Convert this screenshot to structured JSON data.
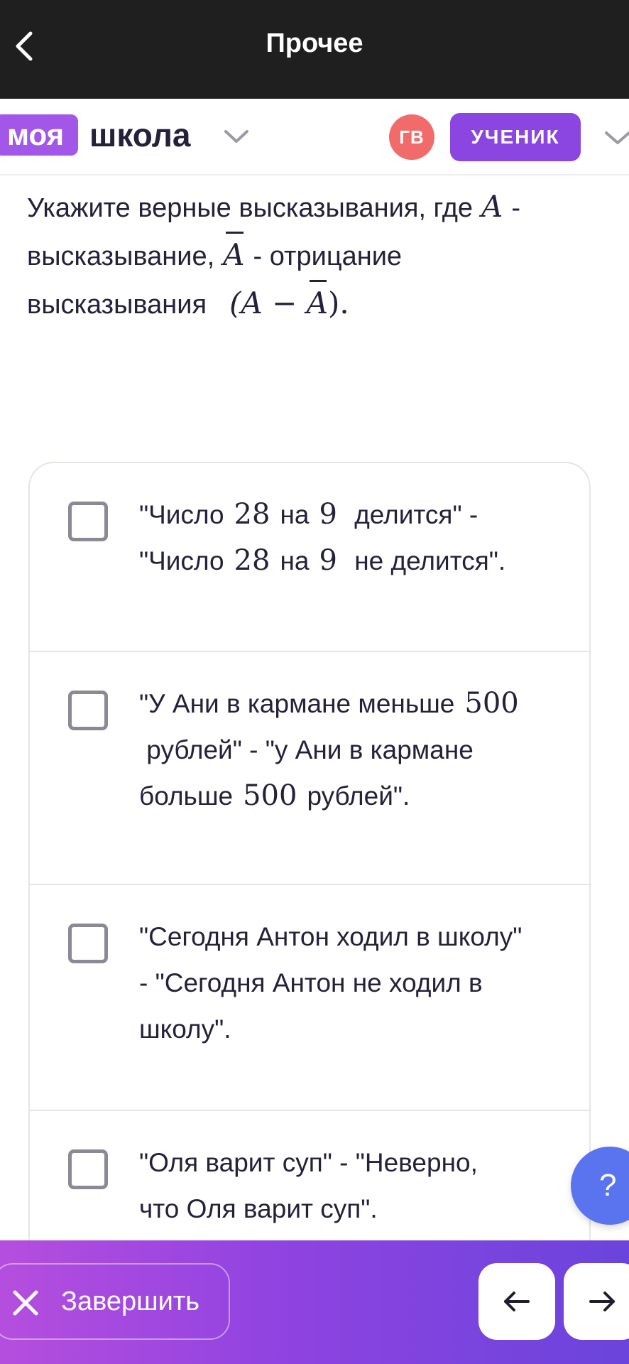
{
  "topbar": {
    "title": "Прочее"
  },
  "header": {
    "brand_box": "моя",
    "brand_text": "школа",
    "avatar_initials": "ГВ",
    "role_label": "УЧЕНИК"
  },
  "question": {
    "part1": "Укажите верные высказывания, где",
    "var_a": "A",
    "part2": "-",
    "part3": "высказывание,",
    "var_abar": "A",
    "part4": "- отрицание",
    "part5": "высказывания",
    "formula_open": "(A − ",
    "formula_abar": "A",
    "formula_close": ")."
  },
  "options": [
    {
      "l1": "\"Число",
      "n1": "28",
      "l2": "на",
      "n2": "9",
      "l3": "делится\" -",
      "l4": "\"Число",
      "n3": "28",
      "l5": "на",
      "n4": "9",
      "l6": "не делится\".",
      "checked": false
    },
    {
      "l1": "\"У Ани в кармане меньше",
      "n1": "500",
      "l2": "рублей\" - \"у Ани в кармане",
      "l3": "больше",
      "n2": "500",
      "l4": "рублей\".",
      "checked": false
    },
    {
      "l1": "\"Сегодня Антон ходил в школу\"",
      "l2": "- \"Сегодня Антон не ходил в",
      "l3": "школу\".",
      "checked": false
    },
    {
      "l1": "\"Оля варит суп\" - \"Неверно,",
      "l2": "что Оля варит суп\".",
      "checked": false
    }
  ],
  "help": {
    "label": "?"
  },
  "bottombar": {
    "finish_label": "Завершить"
  },
  "colors": {
    "brand_purple": "#a357e8",
    "role_purple": "#8b45e0",
    "avatar_red": "#f26b6b",
    "help_blue": "#5a73ee",
    "topbar_bg": "#1f1f1f"
  },
  "icons": {
    "back": "chevron-left-icon",
    "brand_dropdown": "chevron-down-icon",
    "role_dropdown": "chevron-down-icon",
    "finish": "close-icon",
    "prev": "arrow-left-icon",
    "next": "arrow-right-icon"
  }
}
